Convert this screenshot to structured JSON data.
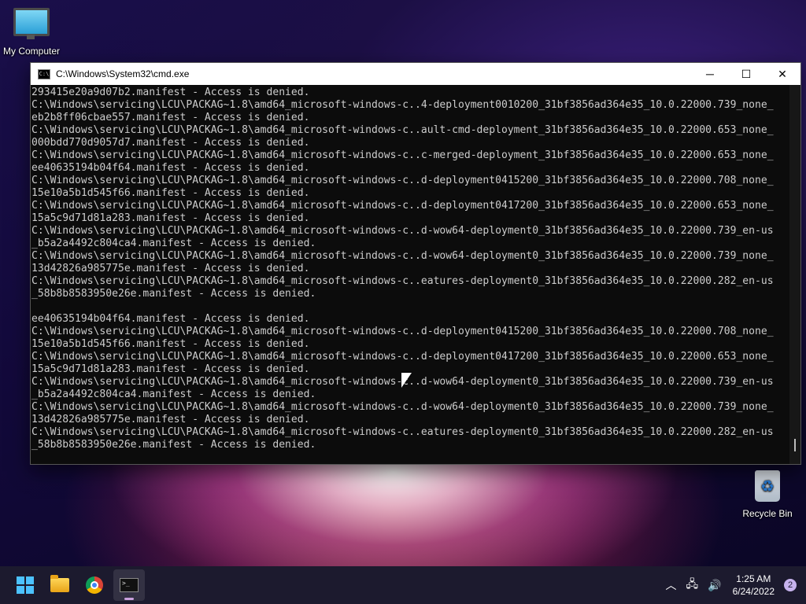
{
  "desktop": {
    "my_computer_label": "My Computer",
    "recycle_bin_label": "Recycle Bin"
  },
  "window": {
    "title": "C:\\Windows\\System32\\cmd.exe",
    "icon_text": "C:\\",
    "minimize": "─",
    "maximize": "☐",
    "close": "✕",
    "output": "293415e20a9d07b2.manifest - Access is denied.\nC:\\Windows\\servicing\\LCU\\PACKAG~1.8\\amd64_microsoft-windows-c..4-deployment0010200_31bf3856ad364e35_10.0.22000.739_none_\neb2b8ff06cbae557.manifest - Access is denied.\nC:\\Windows\\servicing\\LCU\\PACKAG~1.8\\amd64_microsoft-windows-c..ault-cmd-deployment_31bf3856ad364e35_10.0.22000.653_none_\n000bdd770d9057d7.manifest - Access is denied.\nC:\\Windows\\servicing\\LCU\\PACKAG~1.8\\amd64_microsoft-windows-c..c-merged-deployment_31bf3856ad364e35_10.0.22000.653_none_\nee40635194b04f64.manifest - Access is denied.\nC:\\Windows\\servicing\\LCU\\PACKAG~1.8\\amd64_microsoft-windows-c..d-deployment0415200_31bf3856ad364e35_10.0.22000.708_none_\n15e10a5b1d545f66.manifest - Access is denied.\nC:\\Windows\\servicing\\LCU\\PACKAG~1.8\\amd64_microsoft-windows-c..d-deployment0417200_31bf3856ad364e35_10.0.22000.653_none_\n15a5c9d71d81a283.manifest - Access is denied.\nC:\\Windows\\servicing\\LCU\\PACKAG~1.8\\amd64_microsoft-windows-c..d-wow64-deployment0_31bf3856ad364e35_10.0.22000.739_en-us\n_b5a2a4492c804ca4.manifest - Access is denied.\nC:\\Windows\\servicing\\LCU\\PACKAG~1.8\\amd64_microsoft-windows-c..d-wow64-deployment0_31bf3856ad364e35_10.0.22000.739_none_\n13d42826a985775e.manifest - Access is denied.\nC:\\Windows\\servicing\\LCU\\PACKAG~1.8\\amd64_microsoft-windows-c..eatures-deployment0_31bf3856ad364e35_10.0.22000.282_en-us\n_58b8b8583950e26e.manifest - Access is denied.\n\nee40635194b04f64.manifest - Access is denied.\nC:\\Windows\\servicing\\LCU\\PACKAG~1.8\\amd64_microsoft-windows-c..d-deployment0415200_31bf3856ad364e35_10.0.22000.708_none_\n15e10a5b1d545f66.manifest - Access is denied.\nC:\\Windows\\servicing\\LCU\\PACKAG~1.8\\amd64_microsoft-windows-c..d-deployment0417200_31bf3856ad364e35_10.0.22000.653_none_\n15a5c9d71d81a283.manifest - Access is denied.\nC:\\Windows\\servicing\\LCU\\PACKAG~1.8\\amd64_microsoft-windows-c..d-wow64-deployment0_31bf3856ad364e35_10.0.22000.739_en-us\n_b5a2a4492c804ca4.manifest - Access is denied.\nC:\\Windows\\servicing\\LCU\\PACKAG~1.8\\amd64_microsoft-windows-c..d-wow64-deployment0_31bf3856ad364e35_10.0.22000.739_none_\n13d42826a985775e.manifest - Access is denied.\nC:\\Windows\\servicing\\LCU\\PACKAG~1.8\\amd64_microsoft-windows-c..eatures-deployment0_31bf3856ad364e35_10.0.22000.282_en-us\n_58b8b8583950e26e.manifest - Access is denied."
  },
  "taskbar": {
    "terminal_icon_text": ">_",
    "tray_chevron": "︿",
    "network_icon": "🖧",
    "volume_icon": "🔊",
    "time": "1:25 AM",
    "date": "6/24/2022",
    "notification_count": "2"
  },
  "colors": {
    "console_bg": "#0c0c0c",
    "console_fg": "#cccccc",
    "taskbar_bg": "#1c1a2e",
    "start_blue": "#4cc2ff"
  }
}
